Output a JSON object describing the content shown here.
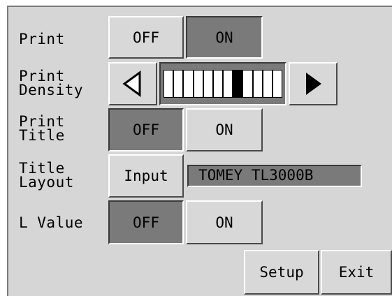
{
  "rows": {
    "print": {
      "label": "Print",
      "off": "OFF",
      "on": "ON",
      "selected": "ON"
    },
    "density": {
      "label": "Print\nDensity",
      "level": 8,
      "max": 12
    },
    "print_title": {
      "label": "Print\nTitle",
      "off": "OFF",
      "on": "ON",
      "selected": "OFF"
    },
    "title_layout": {
      "label": "Title\nLayout",
      "input_label": "Input",
      "value": "TOMEY TL3000B"
    },
    "l_value": {
      "label": "L Value",
      "off": "OFF",
      "on": "ON",
      "selected": "OFF"
    }
  },
  "footer": {
    "setup": "Setup",
    "exit": "Exit"
  },
  "icons": {
    "left": "left-arrow-icon",
    "right": "right-arrow-icon"
  }
}
